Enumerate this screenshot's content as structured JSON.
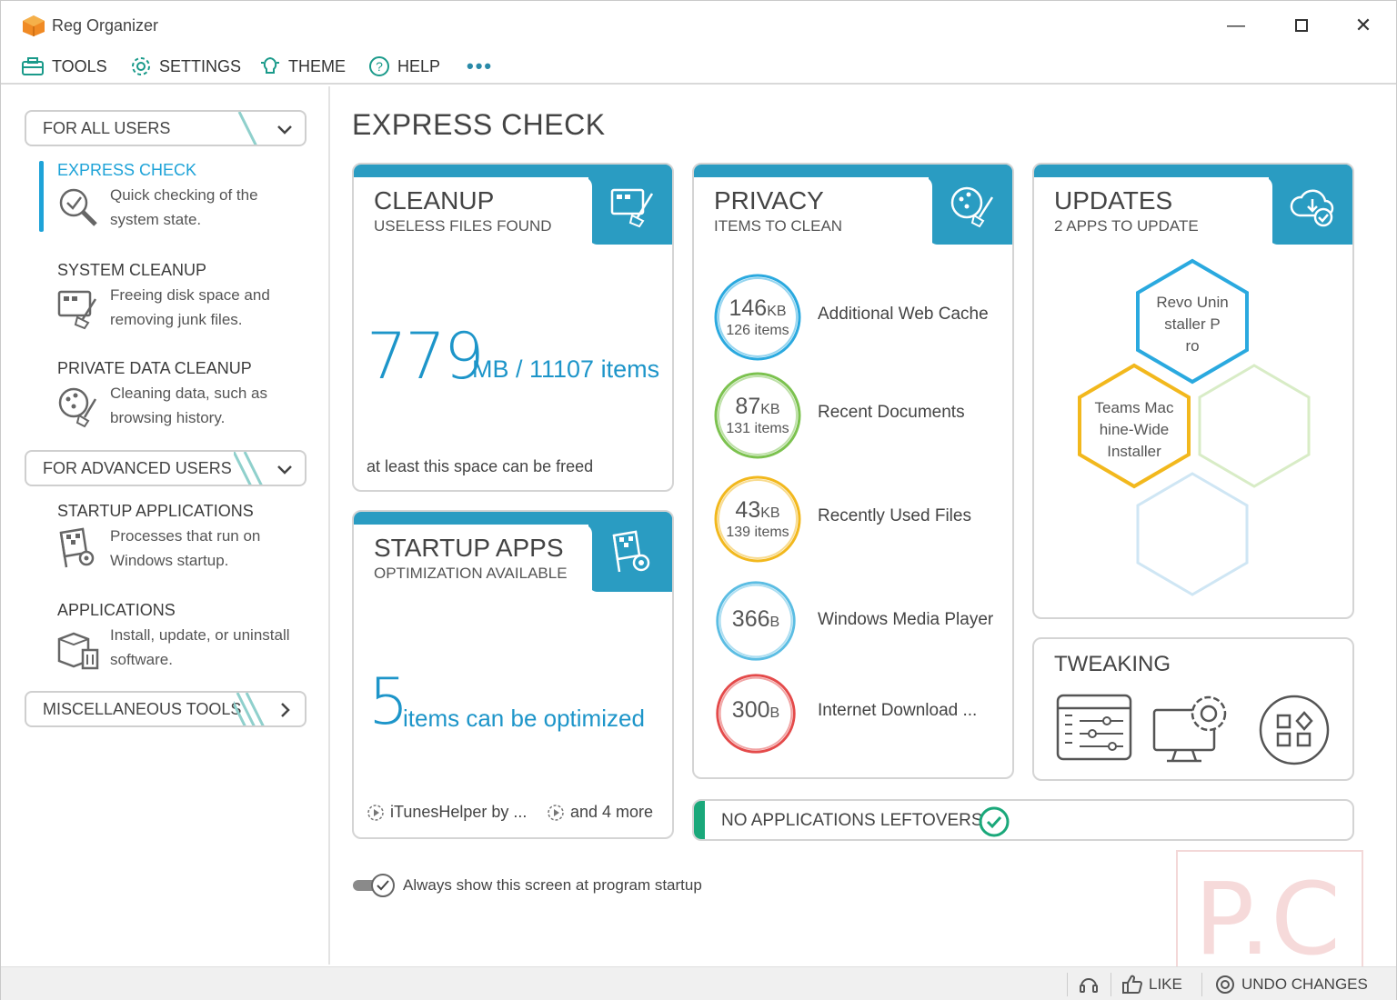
{
  "window": {
    "title": "Reg Organizer"
  },
  "menu": {
    "tools": "TOOLS",
    "settings": "SETTINGS",
    "theme": "THEME",
    "help": "HELP",
    "more": "•••"
  },
  "sidebar": {
    "group_all_users": "FOR ALL USERS",
    "group_advanced": "FOR ADVANCED USERS",
    "group_misc": "MISCELLANEOUS TOOLS",
    "items": [
      {
        "title": "EXPRESS CHECK",
        "desc": "Quick checking of the system state.",
        "icon": "magnifier-check-icon",
        "active": true
      },
      {
        "title": "SYSTEM CLEANUP",
        "desc": "Freeing disk space and removing junk files.",
        "icon": "broom-screen-icon"
      },
      {
        "title": "PRIVATE DATA CLEANUP",
        "desc": "Cleaning data, such as browsing history.",
        "icon": "privacy-broom-icon"
      },
      {
        "title": "STARTUP APPLICATIONS",
        "desc": "Processes that run on Windows startup.",
        "icon": "flag-gear-icon"
      },
      {
        "title": "APPLICATIONS",
        "desc": "Install, update, or uninstall software.",
        "icon": "box-trash-icon"
      }
    ]
  },
  "main": {
    "title": "EXPRESS CHECK",
    "cleanup": {
      "title": "CLEANUP",
      "subtitle": "USELESS FILES FOUND",
      "value": "779",
      "unit": "MB / 11107 items",
      "footer": "at least this space can be freed"
    },
    "startup": {
      "title": "STARTUP APPS",
      "subtitle": "OPTIMIZATION AVAILABLE",
      "value": "5",
      "unit": "items can be optimized",
      "item1": "iTunesHelper by ...",
      "item2": "and 4 more"
    },
    "privacy": {
      "title": "PRIVACY",
      "subtitle": "ITEMS TO CLEAN",
      "rows": [
        {
          "value": "146",
          "unit": "KB",
          "items": "126 items",
          "label": "Additional Web Cache",
          "color": "#2aa9df"
        },
        {
          "value": "87",
          "unit": "KB",
          "items": "131 items",
          "label": "Recent Documents",
          "color": "#7cc24f"
        },
        {
          "value": "43",
          "unit": "KB",
          "items": "139 items",
          "label": "Recently Used Files",
          "color": "#f2b81d"
        },
        {
          "value": "366",
          "unit": "B",
          "items": "",
          "label": "Windows Media Player",
          "color": "#5bbde3"
        },
        {
          "value": "300",
          "unit": "B",
          "items": "",
          "label": "Internet Download ...",
          "color": "#e44a4a"
        }
      ]
    },
    "updates": {
      "title": "UPDATES",
      "subtitle": "2 APPS TO UPDATE",
      "apps": [
        {
          "name": "Revo Uninstaller Pro",
          "l1": "Revo Unin",
          "l2": "staller P",
          "l3": "ro",
          "color": "#2aa9df"
        },
        {
          "name": "Teams Machine-Wide Installer",
          "l1": "Teams Mac",
          "l2": "hine-Wide",
          "l3": "Installer",
          "color": "#f2b81d"
        }
      ]
    },
    "tweaking": {
      "title": "TWEAKING"
    },
    "leftovers": {
      "label": "NO APPLICATIONS LEFTOVERS"
    },
    "startup_toggle": {
      "label": "Always show this screen at program startup",
      "on": true
    }
  },
  "statusbar": {
    "like": "LIKE",
    "undo": "UNDO CHANGES"
  },
  "watermark": {
    "text": "P.C"
  }
}
